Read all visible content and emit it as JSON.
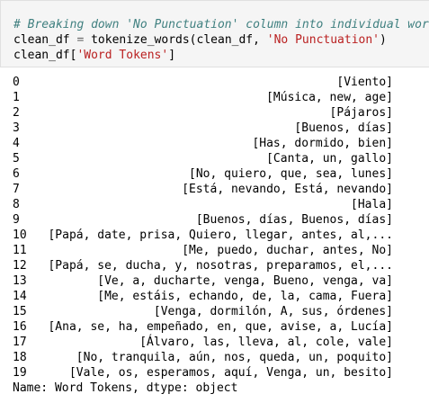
{
  "code": {
    "line1": "# Breaking down 'No Punctuation' column into individual words",
    "line2_var": "clean_df",
    "line2_op": " = ",
    "line2_call": "tokenize_words(clean_df, ",
    "line2_str": "'No Punctuation'",
    "line2_end": ")",
    "line3_var": "clean_df[",
    "line3_str": "'Word Tokens'",
    "line3_end": "]"
  },
  "output": {
    "rows": [
      {
        "index": "0",
        "value": "[Viento]"
      },
      {
        "index": "1",
        "value": "[Música, new, age]"
      },
      {
        "index": "2",
        "value": "[Pájaros]"
      },
      {
        "index": "3",
        "value": "[Buenos, días]"
      },
      {
        "index": "4",
        "value": "[Has, dormido, bien]"
      },
      {
        "index": "5",
        "value": "[Canta, un, gallo]"
      },
      {
        "index": "6",
        "value": "[No, quiero, que, sea, lunes]"
      },
      {
        "index": "7",
        "value": "[Está, nevando, Está, nevando]"
      },
      {
        "index": "8",
        "value": "[Hala]"
      },
      {
        "index": "9",
        "value": "[Buenos, días, Buenos, días]"
      },
      {
        "index": "10",
        "value": "[Papá, date, prisa, Quiero, llegar, antes, al,..."
      },
      {
        "index": "11",
        "value": "[Me, puedo, duchar, antes, No]"
      },
      {
        "index": "12",
        "value": "[Papá, se, ducha, y, nosotras, preparamos, el,..."
      },
      {
        "index": "13",
        "value": "[Ve, a, ducharte, venga, Bueno, venga, va]"
      },
      {
        "index": "14",
        "value": "[Me, estáis, echando, de, la, cama, Fuera]"
      },
      {
        "index": "15",
        "value": "[Venga, dormilón, A, sus, órdenes]"
      },
      {
        "index": "16",
        "value": "[Ana, se, ha, empeñado, en, que, avise, a, Lucía]"
      },
      {
        "index": "17",
        "value": "[Álvaro, las, lleva, al, cole, vale]"
      },
      {
        "index": "18",
        "value": "[No, tranquila, aún, nos, queda, un, poquito]"
      },
      {
        "index": "19",
        "value": "[Vale, os, esperamos, aquí, Venga, un, besito]"
      }
    ],
    "footer": "Name: Word Tokens, dtype: object"
  }
}
